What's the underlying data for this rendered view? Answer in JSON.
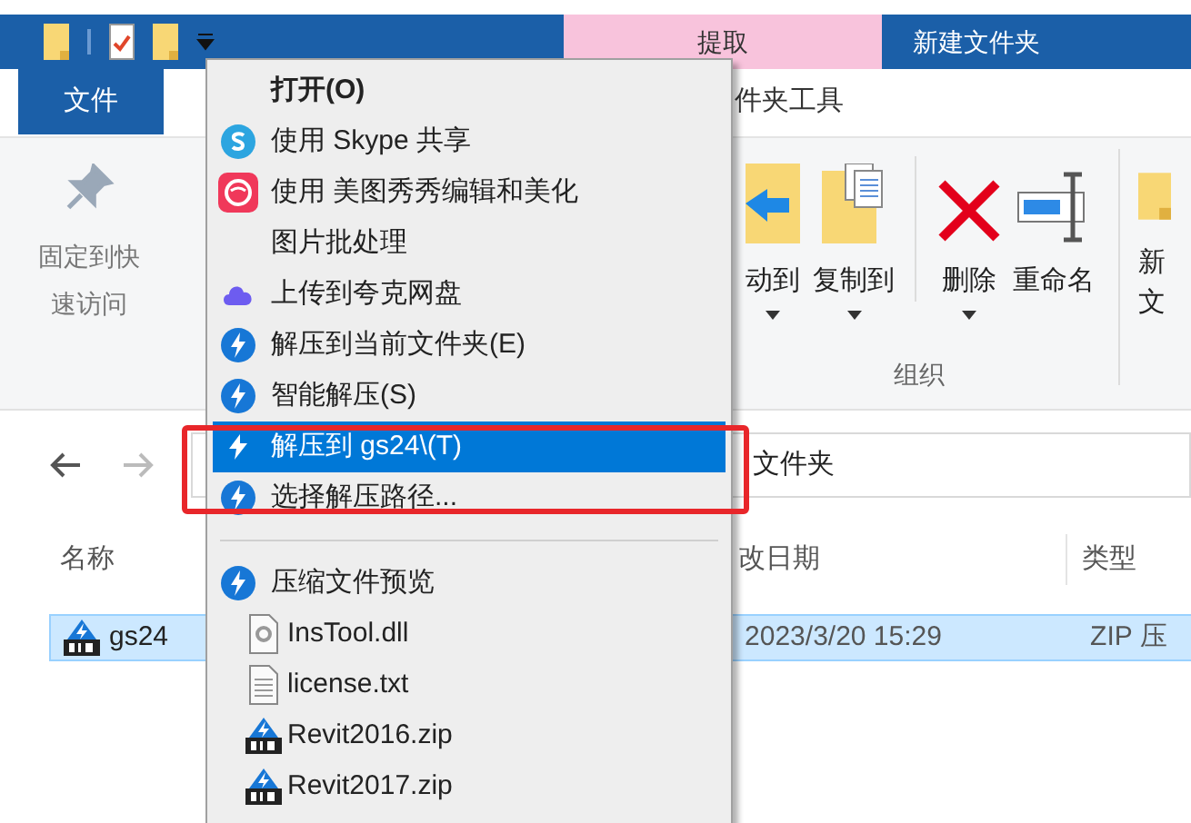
{
  "title_bar": {
    "context_tab": "提取",
    "title": "新建文件夹"
  },
  "ribbon_tabs": [
    {
      "label": "文件",
      "selected": true
    },
    {
      "label": "件夹工具",
      "selected": false
    }
  ],
  "ribbon": {
    "pin_label": "固定到快速访问",
    "group_label": "组织",
    "buttons": [
      {
        "label": "动到",
        "has_menu": true
      },
      {
        "label": "复制到",
        "has_menu": true
      },
      {
        "label": "删除",
        "has_menu": true
      },
      {
        "label": "重命名",
        "has_menu": false
      }
    ],
    "cut_button": {
      "line_1": "新",
      "line_2": "文"
    }
  },
  "address_bar": {
    "path": "文件夹"
  },
  "columns": [
    "名称",
    "改日期",
    "类型"
  ],
  "files": [
    {
      "name": "gs24",
      "modified": "2023/3/20 15:29",
      "type": "ZIP 压",
      "selected": true
    }
  ],
  "menu": {
    "items": [
      {
        "kind": "default",
        "label": "打开(O)",
        "selected": false
      },
      {
        "kind": "item",
        "label": "使用 Skype 共享",
        "selected": false
      },
      {
        "kind": "item",
        "label": "使用 美图秀秀编辑和美化",
        "selected": false
      },
      {
        "kind": "item",
        "label": "图片批处理",
        "selected": false
      },
      {
        "kind": "item",
        "label": "上传到夸克网盘",
        "selected": false
      },
      {
        "kind": "item",
        "label": "解压到当前文件夹(E)",
        "selected": false
      },
      {
        "kind": "item",
        "label": "智能解压(S)",
        "selected": false
      },
      {
        "kind": "item",
        "label": "解压到 gs24\\(T)",
        "selected": true
      },
      {
        "kind": "item",
        "label": "选择解压路径...",
        "selected": false
      },
      {
        "kind": "separator"
      },
      {
        "kind": "item",
        "label": "压缩文件预览",
        "selected": false
      },
      {
        "kind": "sub",
        "label": "InsTool.dll",
        "selected": false
      },
      {
        "kind": "sub",
        "label": "license.txt",
        "selected": false
      },
      {
        "kind": "sub",
        "label": "Revit2016.zip",
        "selected": false
      },
      {
        "kind": "sub",
        "label": "Revit2017.zip",
        "selected": false
      }
    ]
  }
}
